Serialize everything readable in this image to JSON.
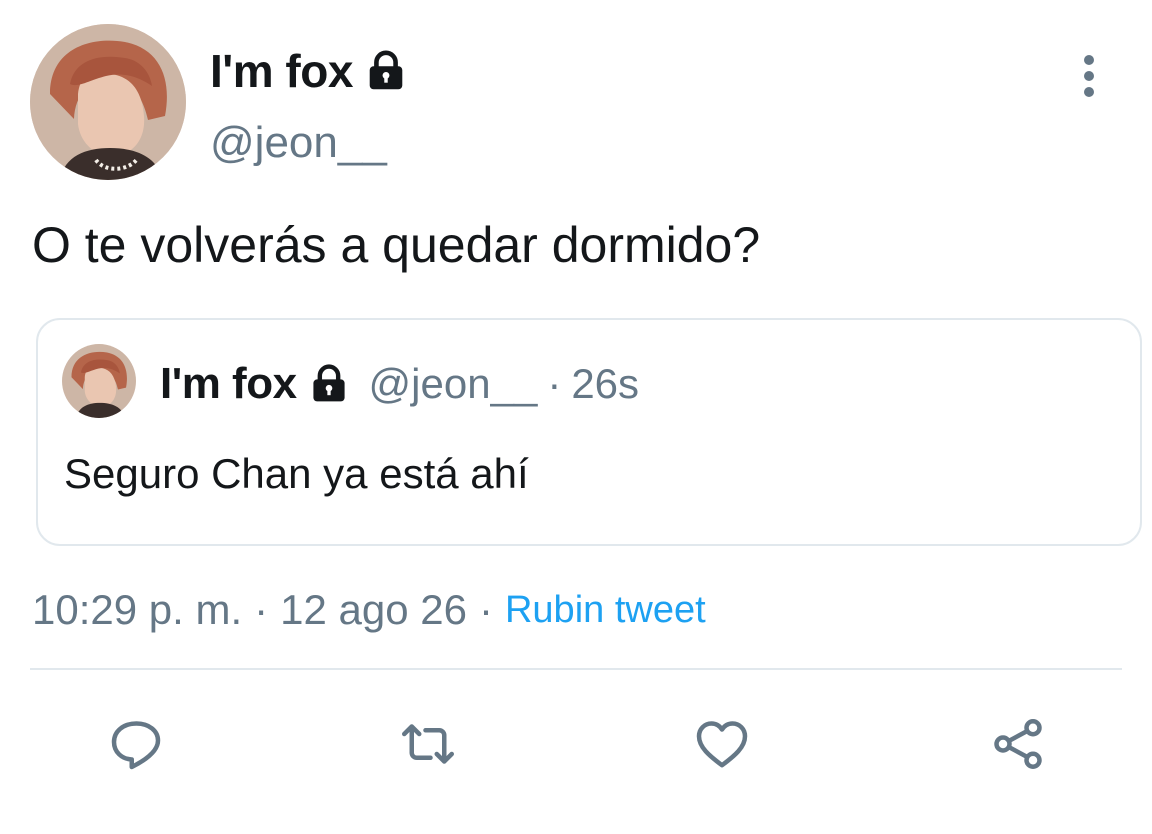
{
  "author": {
    "display_name": "I'm fox",
    "handle": "@jeon__",
    "protected_icon": "lock-icon"
  },
  "tweet": {
    "text": "O te volverás a quedar dormido?",
    "time": "10:29 p. m.",
    "date": "12 ago 26",
    "source": "Rubin tweet",
    "separator": "·"
  },
  "quoted": {
    "display_name": "I'm fox",
    "handle": "@jeon__",
    "separator": "·",
    "age": "26s",
    "text": "Seguro Chan ya está ahí"
  },
  "actions": [
    {
      "name": "reply",
      "icon": "reply-icon"
    },
    {
      "name": "retweet",
      "icon": "retweet-icon"
    },
    {
      "name": "like",
      "icon": "heart-icon"
    },
    {
      "name": "share",
      "icon": "share-icon"
    }
  ],
  "colors": {
    "text": "#14171a",
    "secondary": "#657786",
    "link": "#1da1f2",
    "border": "#e1e8ed"
  }
}
